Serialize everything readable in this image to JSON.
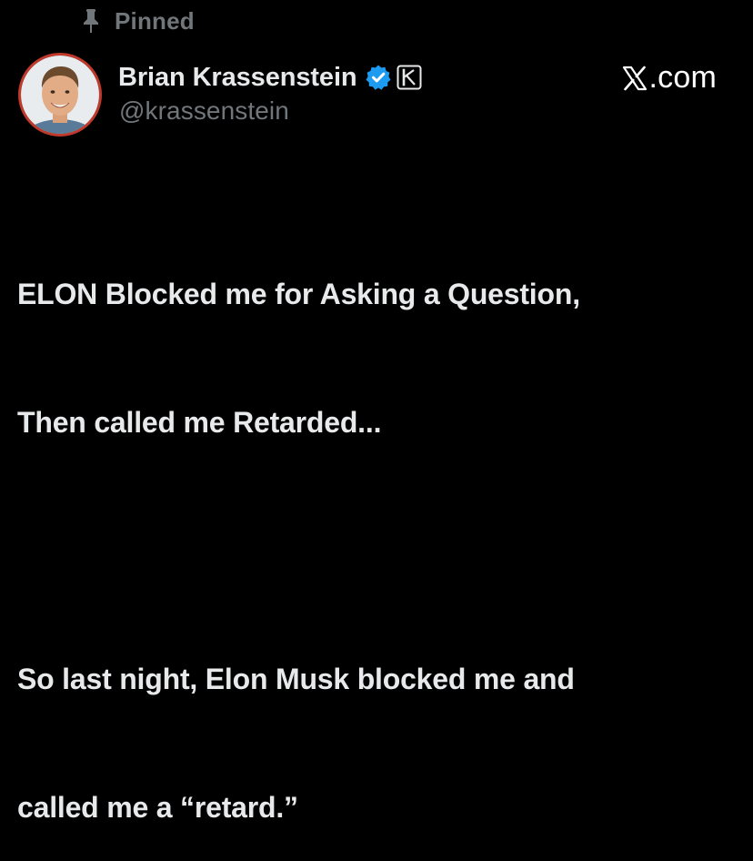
{
  "pinned": {
    "label": "Pinned",
    "icon": "pin-icon"
  },
  "author": {
    "display_name": "Brian Krassenstein",
    "handle": "@krassenstein",
    "verified_icon": "verified-badge-icon",
    "affiliate_icon": "affiliate-k-badge-icon",
    "avatar_icon": "avatar"
  },
  "site": {
    "label": ".com",
    "logo_icon": "x-logo-icon"
  },
  "post": {
    "paragraph_1_line_1": "ELON Blocked me for Asking a Question,",
    "paragraph_1_line_2": "Then called me Retarded...",
    "paragraph_2_line_1": "So last night, Elon Musk blocked me and",
    "paragraph_2_line_2": "called me a “retard.”"
  },
  "colors": {
    "background": "#000000",
    "primary_text": "#e7e9ea",
    "secondary_text": "#71767b",
    "verified_blue": "#1d9bf0",
    "avatar_ring": "#c0392b"
  }
}
